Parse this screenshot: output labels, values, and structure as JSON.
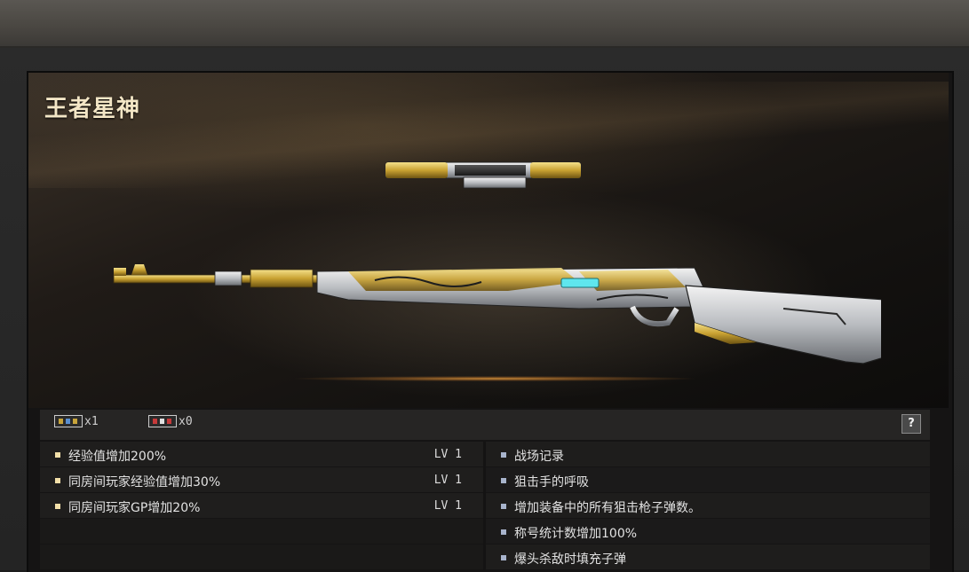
{
  "weapon": {
    "name": "王者星神"
  },
  "stats_bar": {
    "badges": [
      {
        "icon": "gold-badge-icon",
        "count": "x1"
      },
      {
        "icon": "red-badge-icon",
        "count": "x0"
      }
    ],
    "help_label": "?"
  },
  "bonuses": [
    {
      "text": "经验值增加200%",
      "level": "LV 1"
    },
    {
      "text": "同房间玩家经验值增加30%",
      "level": "LV 1"
    },
    {
      "text": "同房间玩家GP增加20%",
      "level": "LV 1"
    }
  ],
  "features": [
    {
      "text": "战场记录"
    },
    {
      "text": "狙击手的呼吸"
    },
    {
      "text": "增加装备中的所有狙击枪子弹数。"
    },
    {
      "text": "称号统计数增加100%"
    },
    {
      "text": "爆头杀敌时填充子弹"
    }
  ],
  "colors": {
    "bonus_bullet": "#f2dfa8",
    "feature_bullet": "#a8b4cc",
    "title": "#f3e6c6",
    "gold_accent": "#c8a43a"
  }
}
